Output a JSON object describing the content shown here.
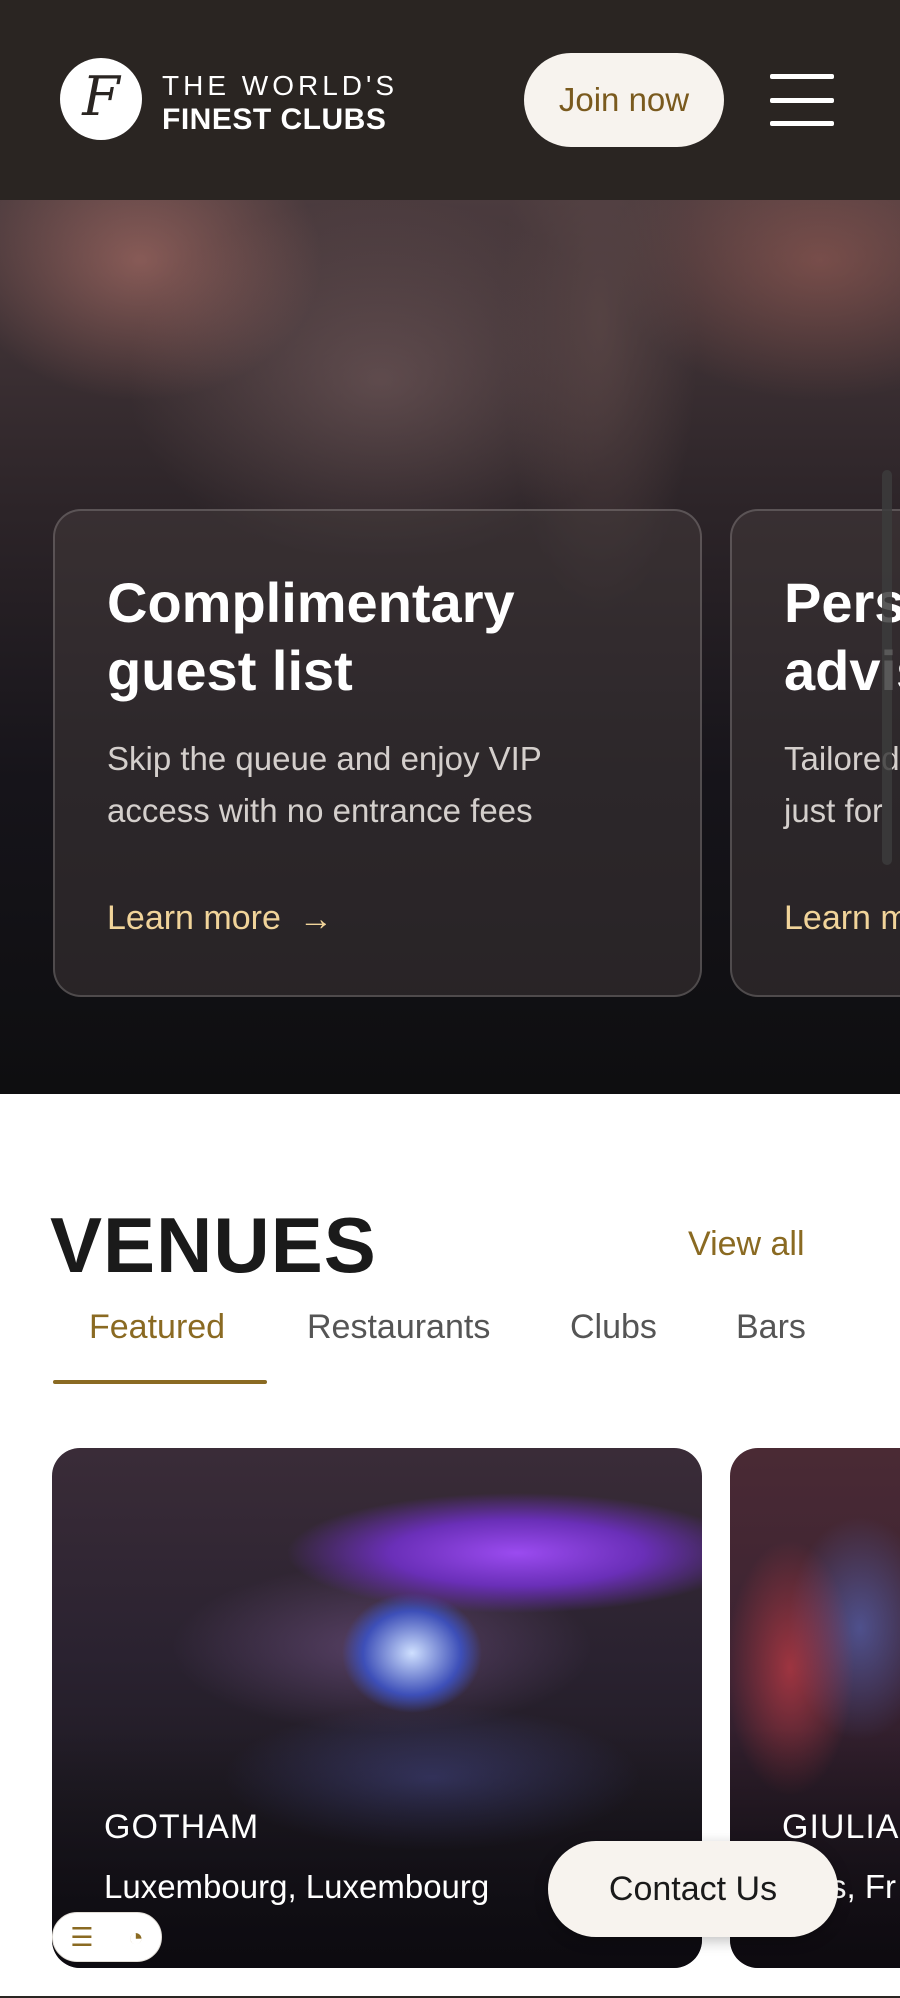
{
  "header": {
    "logo_letter": "F",
    "brand_line1": "THE WORLD'S",
    "brand_line2": "FINEST CLUBS",
    "join_label": "Join now",
    "menu_icon": "hamburger-menu-icon"
  },
  "benefits": [
    {
      "title": "Complimentary\nguest list",
      "description": "Skip the queue and enjoy VIP\naccess with no entrance fees",
      "link": "Learn more"
    },
    {
      "title": "Pers\nadvis",
      "description": "Tailored\njust for",
      "link": "Learn m"
    }
  ],
  "venues": {
    "title": "VENUES",
    "view_all": "View all",
    "tabs": [
      {
        "label": "Featured",
        "active": true
      },
      {
        "label": "Restaurants",
        "active": false
      },
      {
        "label": "Clubs",
        "active": false
      },
      {
        "label": "Bars",
        "active": false
      }
    ],
    "cards": [
      {
        "name": "GOTHAM",
        "location": "Luxembourg, Luxembourg"
      },
      {
        "name": "GIULIA",
        "location": "s, Fr"
      }
    ]
  },
  "contact_label": "Contact Us",
  "cookie_widget": {
    "icons": [
      "checklist-icon",
      "cookie-icon"
    ]
  },
  "colors": {
    "accent": "#8a6a22",
    "header_bg": "#2a2522",
    "link_gold": "#f1d49a"
  }
}
